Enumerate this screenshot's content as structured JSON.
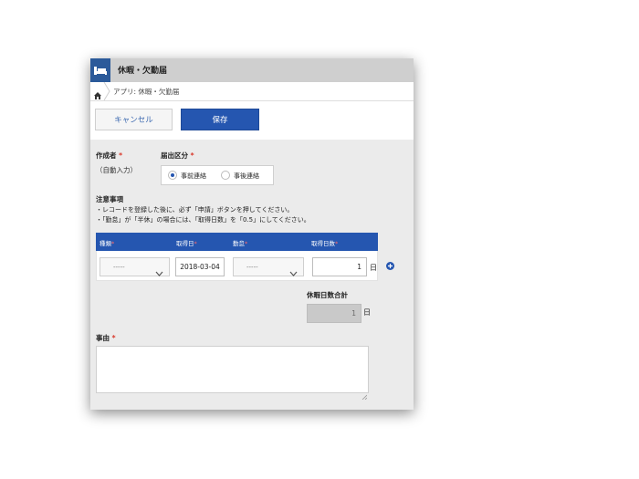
{
  "app": {
    "title": "休暇・欠勤届"
  },
  "breadcrumb": {
    "text": "アプリ: 休暇・欠勤届"
  },
  "toolbar": {
    "cancel_label": "キャンセル",
    "save_label": "保存"
  },
  "form": {
    "creator": {
      "label": "作成者",
      "required_mark": "*",
      "value": "（自動入力）"
    },
    "notice_type": {
      "label": "届出区分",
      "required_mark": "*",
      "options": [
        {
          "label": "事前連絡",
          "selected": true
        },
        {
          "label": "事後連絡",
          "selected": false
        }
      ]
    },
    "notes": {
      "title": "注意事項",
      "lines": [
        "・レコードを登録した後に、必ず「申請」ボタンを押してください。",
        "・「勤怠」が「半休」の場合には、「取得日数」を「0.5」にしてください。"
      ]
    },
    "table": {
      "headers": [
        {
          "label": "種類",
          "mark": "*"
        },
        {
          "label": "取得日",
          "mark": "*"
        },
        {
          "label": "勤怠",
          "mark": "*"
        },
        {
          "label": "取得日数",
          "mark": "*"
        }
      ],
      "row": {
        "type": "-----",
        "date": "2018-03-04",
        "attendance": "-----",
        "days": "1",
        "days_unit": "日"
      }
    },
    "total": {
      "label": "休暇日数合計",
      "value": "1",
      "unit": "日"
    },
    "reason": {
      "label": "事由",
      "required_mark": "*",
      "value": ""
    }
  },
  "colors": {
    "accent": "#2556b0",
    "required": "#d9382b",
    "titlebar": "#cfcfcf"
  }
}
